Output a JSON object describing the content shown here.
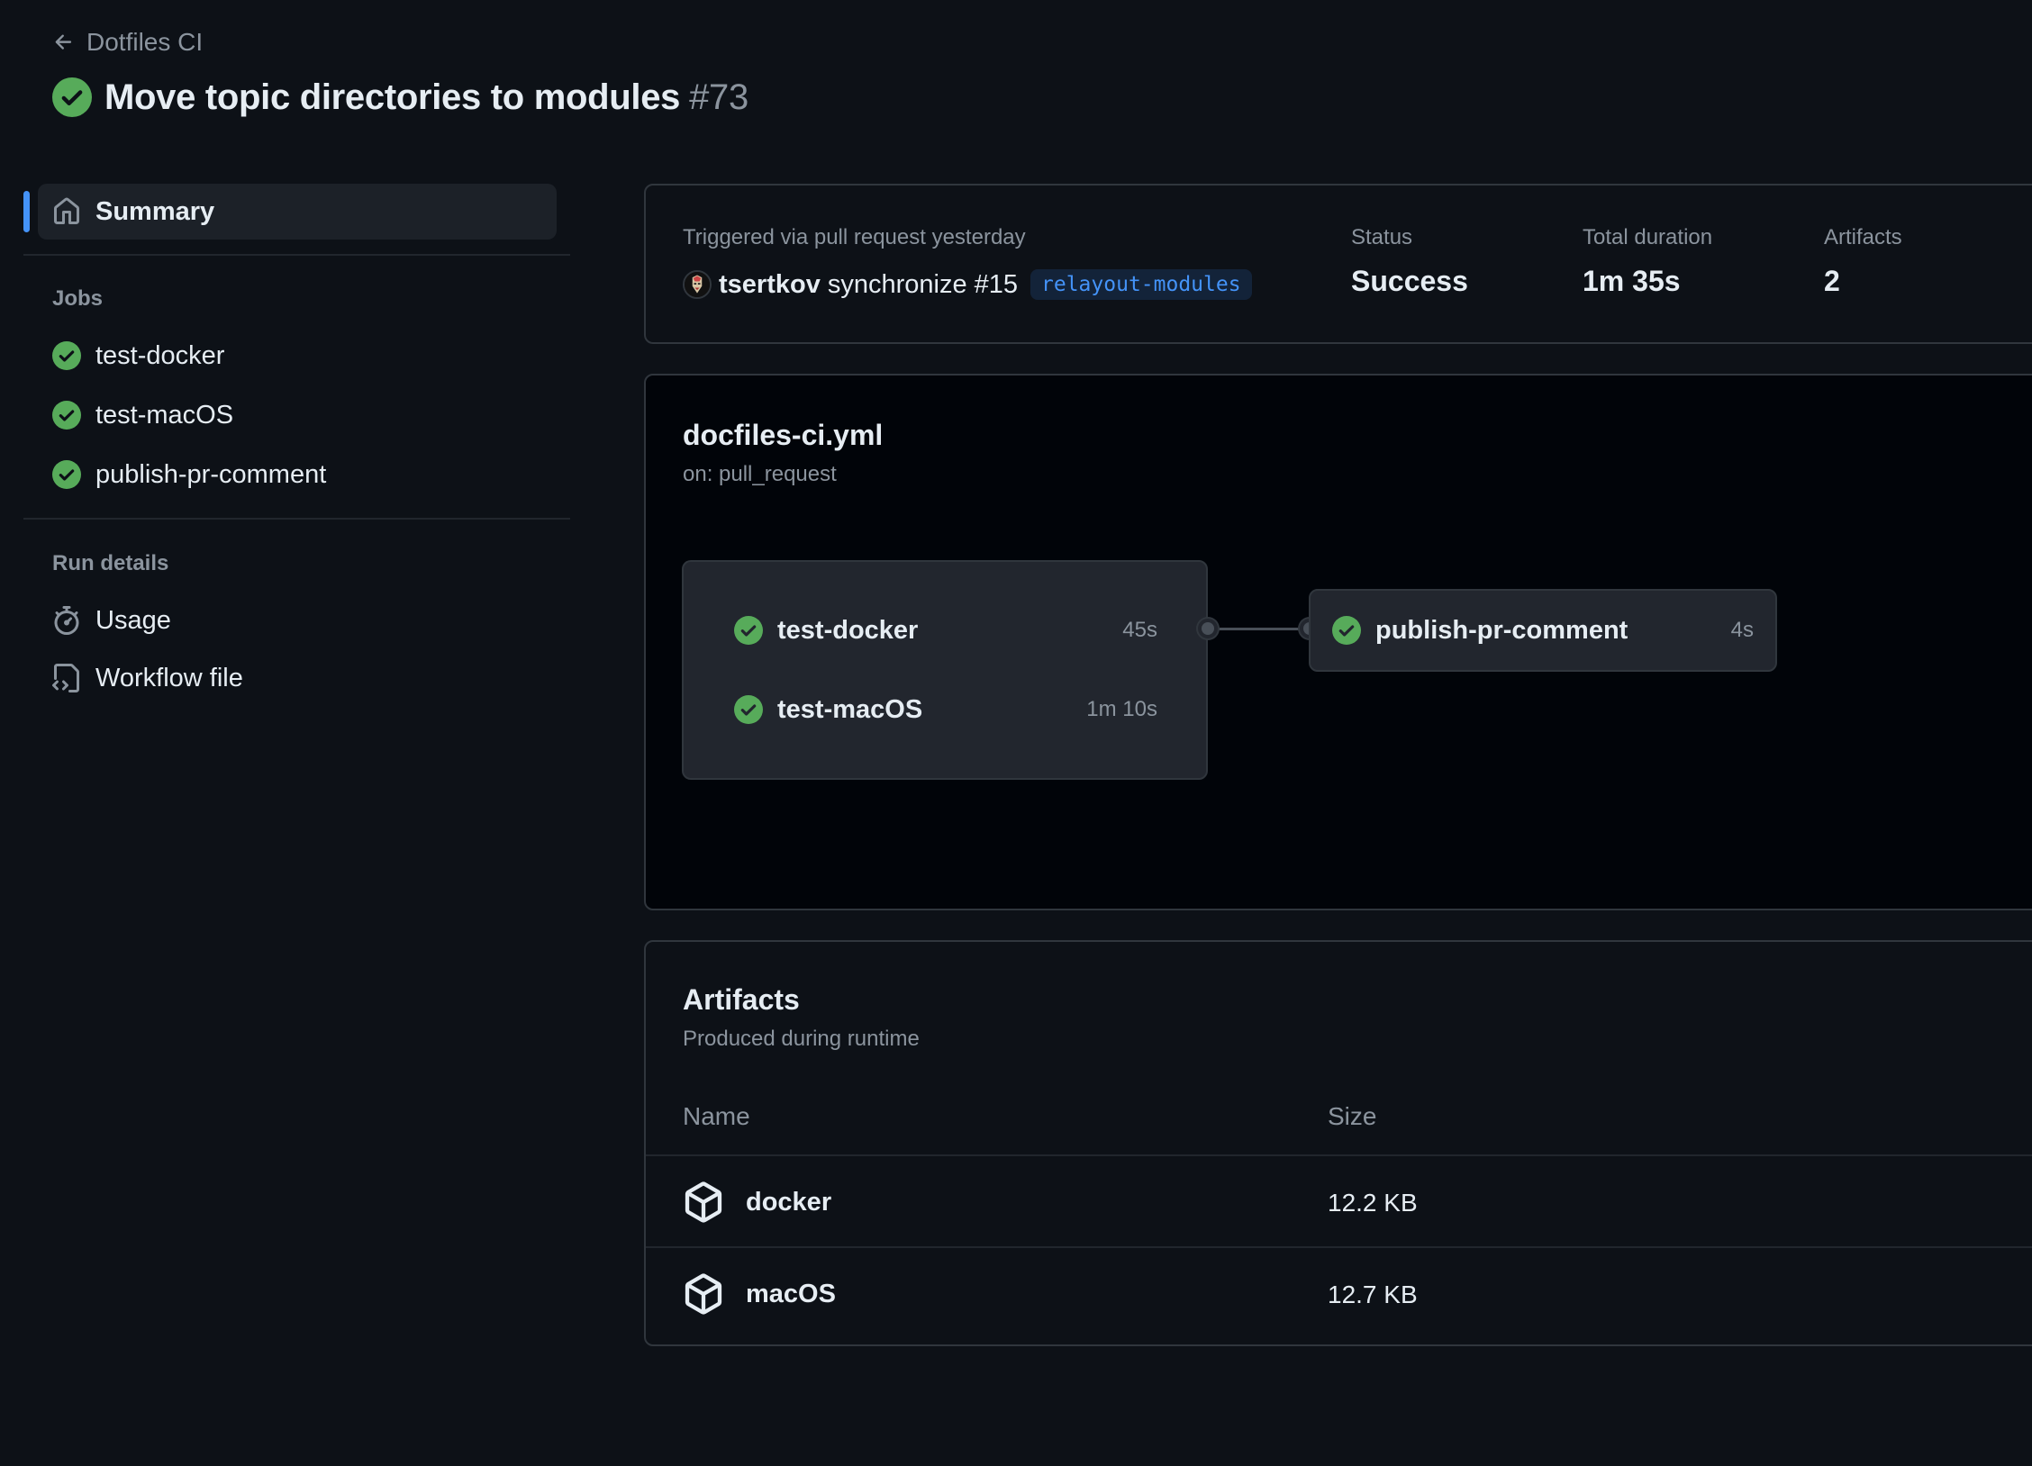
{
  "header": {
    "back_label": "Dotfiles CI",
    "title": "Move topic directories to modules",
    "run_number": "#73",
    "status_icon": "check-circle-icon"
  },
  "sidebar": {
    "summary_label": "Summary",
    "jobs_heading": "Jobs",
    "jobs": [
      {
        "label": "test-docker",
        "status": "success"
      },
      {
        "label": "test-macOS",
        "status": "success"
      },
      {
        "label": "publish-pr-comment",
        "status": "success"
      }
    ],
    "run_details_heading": "Run details",
    "run_details": [
      {
        "label": "Usage",
        "icon": "stopwatch-icon"
      },
      {
        "label": "Workflow file",
        "icon": "file-code-icon"
      }
    ]
  },
  "summary": {
    "trigger_text": "Triggered via pull request yesterday",
    "actor": "tsertkov",
    "action": "synchronize #15",
    "branch": "relayout-modules",
    "status_label": "Status",
    "status_value": "Success",
    "duration_label": "Total duration",
    "duration_value": "1m 35s",
    "artifacts_label": "Artifacts",
    "artifacts_value": "2"
  },
  "workflow": {
    "file": "docfiles-ci.yml",
    "trigger": "on: pull_request",
    "group_jobs": [
      {
        "name": "test-docker",
        "duration": "45s"
      },
      {
        "name": "test-macOS",
        "duration": "1m 10s"
      }
    ],
    "dependent_job": {
      "name": "publish-pr-comment",
      "duration": "4s"
    }
  },
  "artifacts": {
    "title": "Artifacts",
    "subtitle": "Produced during runtime",
    "col_name": "Name",
    "col_size": "Size",
    "rows": [
      {
        "name": "docker",
        "size": "12.2 KB"
      },
      {
        "name": "macOS",
        "size": "12.7 KB"
      }
    ]
  },
  "colors": {
    "success": "#57ab5a",
    "accent": "#4493f8",
    "background": "#0d1117",
    "graph_background": "#010409"
  }
}
